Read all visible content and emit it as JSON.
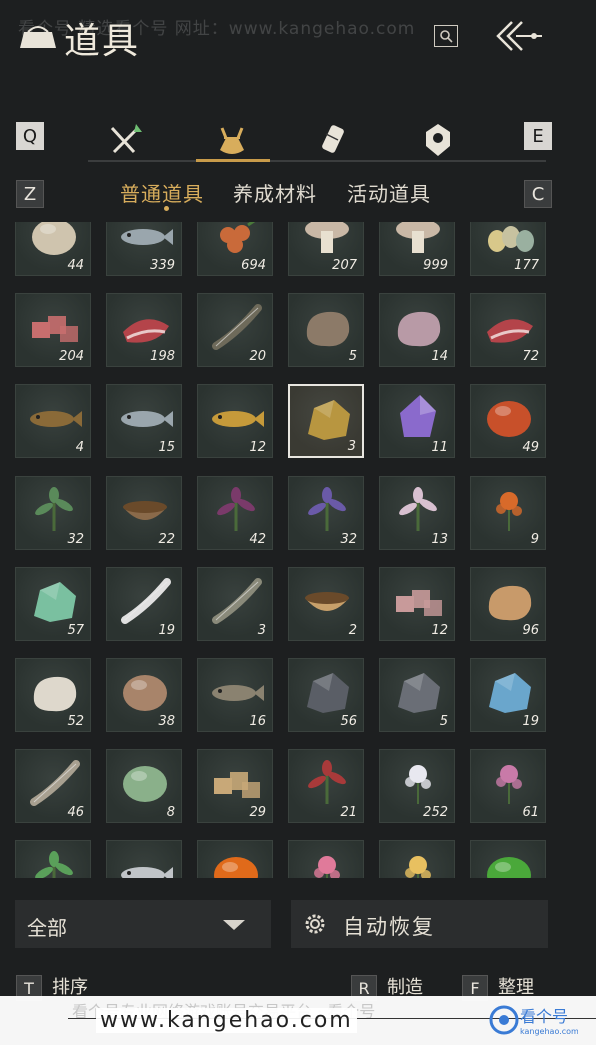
{
  "header": {
    "title": "道具",
    "watermark": "看个号 精选看个号 网址：www.kangehao.com"
  },
  "category_keys": {
    "left": "Q",
    "right": "E"
  },
  "categories": [
    {
      "name": "equipment-tab",
      "icon": "crossed-swords-icon"
    },
    {
      "name": "items-tab",
      "icon": "pouch-icon",
      "active": true
    },
    {
      "name": "scroll-tab",
      "icon": "scroll-icon"
    },
    {
      "name": "gem-tab",
      "icon": "gem-icon"
    }
  ],
  "subtab_keys": {
    "left": "Z",
    "right": "C"
  },
  "subtabs": [
    "普通道具",
    "养成材料",
    "活动道具"
  ],
  "items": [
    {
      "art": "sack-icon",
      "qty": "44"
    },
    {
      "art": "fish-icon",
      "qty": "339"
    },
    {
      "art": "berries-icon",
      "qty": "694"
    },
    {
      "art": "mushroom-icon",
      "qty": "207"
    },
    {
      "art": "mushroom-icon",
      "qty": "999"
    },
    {
      "art": "eggs-icon",
      "qty": "177"
    },
    {
      "art": "meat-chunks-icon",
      "qty": "204"
    },
    {
      "art": "steak-icon",
      "qty": "198"
    },
    {
      "art": "feathers-icon",
      "qty": "20"
    },
    {
      "art": "hide-icon",
      "qty": "5"
    },
    {
      "art": "intestine-icon",
      "qty": "14"
    },
    {
      "art": "steak-icon",
      "qty": "72"
    },
    {
      "art": "carp-icon",
      "qty": "4"
    },
    {
      "art": "fish-icon",
      "qty": "15"
    },
    {
      "art": "golden-fish-icon",
      "qty": "12"
    },
    {
      "art": "gold-ore-icon",
      "qty": "3",
      "selected": true
    },
    {
      "art": "amethyst-icon",
      "qty": "11"
    },
    {
      "art": "agate-icon",
      "qty": "49"
    },
    {
      "art": "herb-icon",
      "qty": "32"
    },
    {
      "art": "mortar-icon",
      "qty": "22"
    },
    {
      "art": "purple-leaf-icon",
      "qty": "42"
    },
    {
      "art": "lavender-icon",
      "qty": "32"
    },
    {
      "art": "blossom-icon",
      "qty": "13"
    },
    {
      "art": "orange-flower-icon",
      "qty": "9"
    },
    {
      "art": "jade-icon",
      "qty": "57"
    },
    {
      "art": "white-feather-icon",
      "qty": "19"
    },
    {
      "art": "grass-feather-icon",
      "qty": "3"
    },
    {
      "art": "bowl-icon",
      "qty": "2"
    },
    {
      "art": "raw-meat-icon",
      "qty": "12"
    },
    {
      "art": "fur-icon",
      "qty": "96"
    },
    {
      "art": "wool-icon",
      "qty": "52"
    },
    {
      "art": "pufferfish-icon",
      "qty": "38"
    },
    {
      "art": "spotted-fish-icon",
      "qty": "16"
    },
    {
      "art": "dark-ore-icon",
      "qty": "56"
    },
    {
      "art": "grey-ore-icon",
      "qty": "5"
    },
    {
      "art": "blue-crystal-icon",
      "qty": "19"
    },
    {
      "art": "bone-icon",
      "qty": "46"
    },
    {
      "art": "melon-icon",
      "qty": "8"
    },
    {
      "art": "bundle-icon",
      "qty": "29"
    },
    {
      "art": "red-berry-branch-icon",
      "qty": "21"
    },
    {
      "art": "white-flower-icon",
      "qty": "252"
    },
    {
      "art": "pink-flower-icon",
      "qty": "61"
    },
    {
      "art": "sprout-icon",
      "qty": ""
    },
    {
      "art": "silver-fish-icon",
      "qty": ""
    },
    {
      "art": "persimmon-icon",
      "qty": ""
    },
    {
      "art": "pink-blossom-icon",
      "qty": ""
    },
    {
      "art": "spark-icon",
      "qty": ""
    },
    {
      "art": "green-orb-icon",
      "qty": ""
    }
  ],
  "filter": {
    "label": "全部"
  },
  "auto_restore": {
    "label": "自动恢复"
  },
  "actions": [
    {
      "key": "T",
      "label": "排序"
    },
    {
      "key": "R",
      "label": "制造"
    },
    {
      "key": "F",
      "label": "整理"
    }
  ],
  "banner": {
    "text": "www.kangehao.com",
    "ghost": "看个号专业网络游戏账号交易平台 · 看个号",
    "logo": "看个号",
    "logo_sub": "kangehao.com"
  },
  "colors": {
    "accent": "#d8ad5c",
    "cell_bg": "#2b3330",
    "selected_border": "#e8e6e0",
    "background": "#1d1f20"
  }
}
